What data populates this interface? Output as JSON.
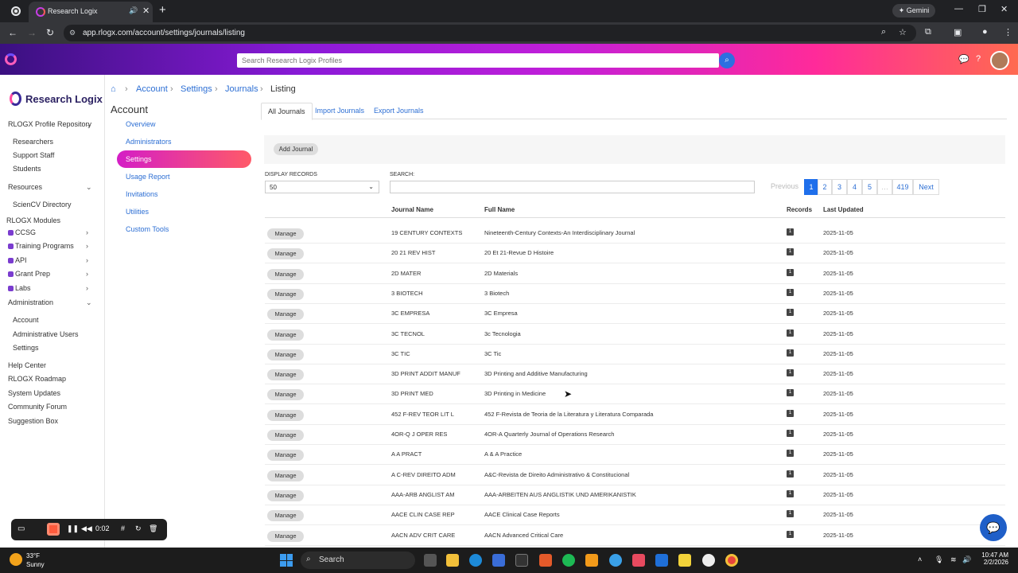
{
  "browser": {
    "tab_title": "Research Logix",
    "url": "app.rlogx.com/account/settings/journals/listing",
    "gemini_label": "Gemini"
  },
  "header": {
    "search_placeholder": "Search Research Logix Profiles"
  },
  "brand": {
    "name": "Research Logix"
  },
  "sidebar": {
    "profile_repo": "RLOGX Profile Repository",
    "profile_items": [
      "Researchers",
      "Support Staff",
      "Students"
    ],
    "resources": "Resources",
    "resource_items": [
      "ScienCV Directory"
    ],
    "modules_label": "RLOGX Modules",
    "modules": [
      "CCSG",
      "Training Programs",
      "API",
      "Grant Prep",
      "Labs"
    ],
    "administration": "Administration",
    "admin_items": [
      "Account",
      "Administrative Users",
      "Settings"
    ],
    "footer_links": [
      "Help Center",
      "RLOGX Roadmap",
      "System Updates",
      "Community Forum",
      "Suggestion Box"
    ]
  },
  "breadcrumb": [
    "Account",
    "Settings",
    "Journals",
    "Listing"
  ],
  "account": {
    "title": "Account",
    "nav": [
      "Overview",
      "Administrators",
      "Settings",
      "Usage Report",
      "Invitations",
      "Utilities",
      "Custom Tools"
    ],
    "active_index": 2
  },
  "tabs": [
    "All Journals",
    "Import Journals",
    "Export Journals"
  ],
  "add_button": "Add Journal",
  "display_label": "Display Records",
  "display_value": "50",
  "search_label": "Search:",
  "pagination": {
    "previous": "Previous",
    "pages": [
      "1",
      "2",
      "3",
      "4",
      "5"
    ],
    "ellipsis": "…",
    "last": "419",
    "next": "Next",
    "current": "1"
  },
  "table": {
    "columns": [
      "Journal Name",
      "Full Name",
      "Records",
      "Last Updated"
    ],
    "manage_label": "Manage",
    "rows": [
      {
        "journal": "19 CENTURY CONTEXTS",
        "full": "Nineteenth-Century Contexts-An Interdisciplinary Journal",
        "records": "1",
        "updated": "2025-11-05"
      },
      {
        "journal": "20 21 REV HIST",
        "full": "20 Et 21-Revue D Histoire",
        "records": "1",
        "updated": "2025-11-05"
      },
      {
        "journal": "2D MATER",
        "full": "2D Materials",
        "records": "1",
        "updated": "2025-11-05"
      },
      {
        "journal": "3 BIOTECH",
        "full": "3 Biotech",
        "records": "1",
        "updated": "2025-11-05"
      },
      {
        "journal": "3C EMPRESA",
        "full": "3C Empresa",
        "records": "1",
        "updated": "2025-11-05"
      },
      {
        "journal": "3C TECNOL",
        "full": "3c Tecnologia",
        "records": "1",
        "updated": "2025-11-05"
      },
      {
        "journal": "3C TIC",
        "full": "3C Tic",
        "records": "1",
        "updated": "2025-11-05"
      },
      {
        "journal": "3D PRINT ADDIT MANUF",
        "full": "3D Printing and Additive Manufacturing",
        "records": "1",
        "updated": "2025-11-05"
      },
      {
        "journal": "3D PRINT MED",
        "full": "3D Printing in Medicine",
        "records": "1",
        "updated": "2025-11-05"
      },
      {
        "journal": "452 F-REV TEOR LIT L",
        "full": "452 F-Revista de Teoria de la Literatura y Literatura Comparada",
        "records": "1",
        "updated": "2025-11-05"
      },
      {
        "journal": "4OR-Q J OPER RES",
        "full": "4OR-A Quarterly Journal of Operations Research",
        "records": "1",
        "updated": "2025-11-05"
      },
      {
        "journal": "A A PRACT",
        "full": "A & A Practice",
        "records": "1",
        "updated": "2025-11-05"
      },
      {
        "journal": "A C-REV DIREITO ADM",
        "full": "A&C-Revista de Direito Administrativo & Constitucional",
        "records": "1",
        "updated": "2025-11-05"
      },
      {
        "journal": "AAA-ARB ANGLIST AM",
        "full": "AAA-ARBEITEN AUS ANGLISTIK UND AMERIKANISTIK",
        "records": "1",
        "updated": "2025-11-05"
      },
      {
        "journal": "AACE CLIN CASE REP",
        "full": "AACE Clinical Case Reports",
        "records": "1",
        "updated": "2025-11-05"
      },
      {
        "journal": "AACN ADV CRIT CARE",
        "full": "AACN Advanced Critical Care",
        "records": "1",
        "updated": "2025-11-05"
      }
    ]
  },
  "recorder": {
    "time": "0:02"
  },
  "taskbar": {
    "temp": "33°F",
    "condition": "Sunny",
    "search": "Search",
    "time": "10:47 AM",
    "date": "2/2/2026"
  }
}
